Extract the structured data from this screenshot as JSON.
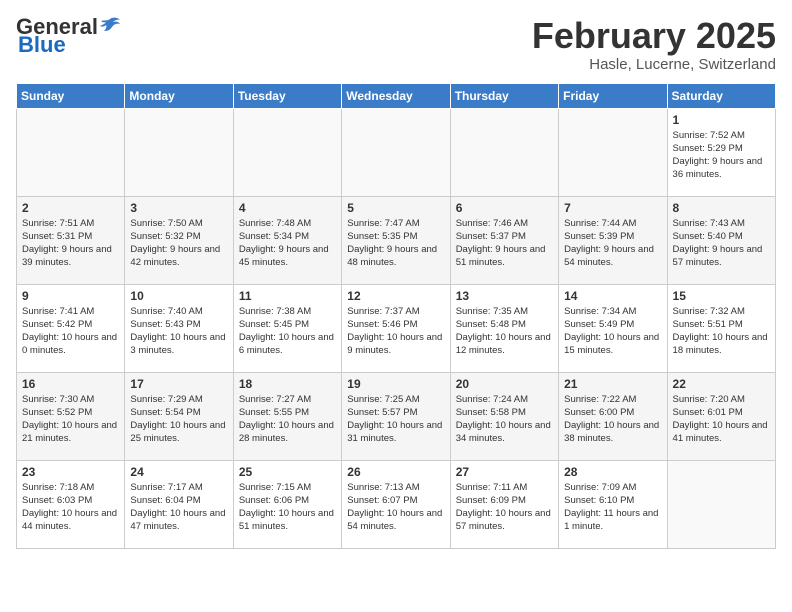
{
  "header": {
    "logo_general": "General",
    "logo_blue": "Blue",
    "title": "February 2025",
    "subtitle": "Hasle, Lucerne, Switzerland"
  },
  "weekdays": [
    "Sunday",
    "Monday",
    "Tuesday",
    "Wednesday",
    "Thursday",
    "Friday",
    "Saturday"
  ],
  "weeks": [
    [
      {
        "day": "",
        "info": ""
      },
      {
        "day": "",
        "info": ""
      },
      {
        "day": "",
        "info": ""
      },
      {
        "day": "",
        "info": ""
      },
      {
        "day": "",
        "info": ""
      },
      {
        "day": "",
        "info": ""
      },
      {
        "day": "1",
        "info": "Sunrise: 7:52 AM\nSunset: 5:29 PM\nDaylight: 9 hours and 36 minutes."
      }
    ],
    [
      {
        "day": "2",
        "info": "Sunrise: 7:51 AM\nSunset: 5:31 PM\nDaylight: 9 hours and 39 minutes."
      },
      {
        "day": "3",
        "info": "Sunrise: 7:50 AM\nSunset: 5:32 PM\nDaylight: 9 hours and 42 minutes."
      },
      {
        "day": "4",
        "info": "Sunrise: 7:48 AM\nSunset: 5:34 PM\nDaylight: 9 hours and 45 minutes."
      },
      {
        "day": "5",
        "info": "Sunrise: 7:47 AM\nSunset: 5:35 PM\nDaylight: 9 hours and 48 minutes."
      },
      {
        "day": "6",
        "info": "Sunrise: 7:46 AM\nSunset: 5:37 PM\nDaylight: 9 hours and 51 minutes."
      },
      {
        "day": "7",
        "info": "Sunrise: 7:44 AM\nSunset: 5:39 PM\nDaylight: 9 hours and 54 minutes."
      },
      {
        "day": "8",
        "info": "Sunrise: 7:43 AM\nSunset: 5:40 PM\nDaylight: 9 hours and 57 minutes."
      }
    ],
    [
      {
        "day": "9",
        "info": "Sunrise: 7:41 AM\nSunset: 5:42 PM\nDaylight: 10 hours and 0 minutes."
      },
      {
        "day": "10",
        "info": "Sunrise: 7:40 AM\nSunset: 5:43 PM\nDaylight: 10 hours and 3 minutes."
      },
      {
        "day": "11",
        "info": "Sunrise: 7:38 AM\nSunset: 5:45 PM\nDaylight: 10 hours and 6 minutes."
      },
      {
        "day": "12",
        "info": "Sunrise: 7:37 AM\nSunset: 5:46 PM\nDaylight: 10 hours and 9 minutes."
      },
      {
        "day": "13",
        "info": "Sunrise: 7:35 AM\nSunset: 5:48 PM\nDaylight: 10 hours and 12 minutes."
      },
      {
        "day": "14",
        "info": "Sunrise: 7:34 AM\nSunset: 5:49 PM\nDaylight: 10 hours and 15 minutes."
      },
      {
        "day": "15",
        "info": "Sunrise: 7:32 AM\nSunset: 5:51 PM\nDaylight: 10 hours and 18 minutes."
      }
    ],
    [
      {
        "day": "16",
        "info": "Sunrise: 7:30 AM\nSunset: 5:52 PM\nDaylight: 10 hours and 21 minutes."
      },
      {
        "day": "17",
        "info": "Sunrise: 7:29 AM\nSunset: 5:54 PM\nDaylight: 10 hours and 25 minutes."
      },
      {
        "day": "18",
        "info": "Sunrise: 7:27 AM\nSunset: 5:55 PM\nDaylight: 10 hours and 28 minutes."
      },
      {
        "day": "19",
        "info": "Sunrise: 7:25 AM\nSunset: 5:57 PM\nDaylight: 10 hours and 31 minutes."
      },
      {
        "day": "20",
        "info": "Sunrise: 7:24 AM\nSunset: 5:58 PM\nDaylight: 10 hours and 34 minutes."
      },
      {
        "day": "21",
        "info": "Sunrise: 7:22 AM\nSunset: 6:00 PM\nDaylight: 10 hours and 38 minutes."
      },
      {
        "day": "22",
        "info": "Sunrise: 7:20 AM\nSunset: 6:01 PM\nDaylight: 10 hours and 41 minutes."
      }
    ],
    [
      {
        "day": "23",
        "info": "Sunrise: 7:18 AM\nSunset: 6:03 PM\nDaylight: 10 hours and 44 minutes."
      },
      {
        "day": "24",
        "info": "Sunrise: 7:17 AM\nSunset: 6:04 PM\nDaylight: 10 hours and 47 minutes."
      },
      {
        "day": "25",
        "info": "Sunrise: 7:15 AM\nSunset: 6:06 PM\nDaylight: 10 hours and 51 minutes."
      },
      {
        "day": "26",
        "info": "Sunrise: 7:13 AM\nSunset: 6:07 PM\nDaylight: 10 hours and 54 minutes."
      },
      {
        "day": "27",
        "info": "Sunrise: 7:11 AM\nSunset: 6:09 PM\nDaylight: 10 hours and 57 minutes."
      },
      {
        "day": "28",
        "info": "Sunrise: 7:09 AM\nSunset: 6:10 PM\nDaylight: 11 hours and 1 minute."
      },
      {
        "day": "",
        "info": ""
      }
    ]
  ]
}
